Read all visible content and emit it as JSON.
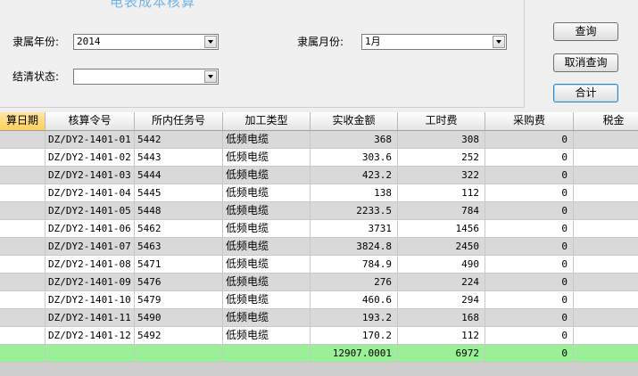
{
  "title": "电表成本核算",
  "filters": {
    "year_label": "隶属年份:",
    "year_value": "2014",
    "month_label": "隶属月份:",
    "month_value": "1月",
    "status_label": "结清状态:",
    "status_value": ""
  },
  "buttons": {
    "query": "查询",
    "cancel_query": "取消查询",
    "total": "合计"
  },
  "columns": [
    "算日期",
    "核算令号",
    "所内任务号",
    "加工类型",
    "实收金额",
    "工时费",
    "采购费",
    "税金"
  ],
  "rows": [
    {
      "order_no": "DZ/DY2-1401-01",
      "task_no": "5442",
      "type": "低频电缆",
      "amount": "368",
      "labor": "308",
      "purchase": "0"
    },
    {
      "order_no": "DZ/DY2-1401-02",
      "task_no": "5443",
      "type": "低频电缆",
      "amount": "303.6",
      "labor": "252",
      "purchase": "0"
    },
    {
      "order_no": "DZ/DY2-1401-03",
      "task_no": "5444",
      "type": "低频电缆",
      "amount": "423.2",
      "labor": "322",
      "purchase": "0"
    },
    {
      "order_no": "DZ/DY2-1401-04",
      "task_no": "5445",
      "type": "低频电缆",
      "amount": "138",
      "labor": "112",
      "purchase": "0"
    },
    {
      "order_no": "DZ/DY2-1401-05",
      "task_no": "5448",
      "type": "低频电缆",
      "amount": "2233.5",
      "labor": "784",
      "purchase": "0"
    },
    {
      "order_no": "DZ/DY2-1401-06",
      "task_no": "5462",
      "type": "低频电缆",
      "amount": "3731",
      "labor": "1456",
      "purchase": "0"
    },
    {
      "order_no": "DZ/DY2-1401-07",
      "task_no": "5463",
      "type": "低频电缆",
      "amount": "3824.8",
      "labor": "2450",
      "purchase": "0"
    },
    {
      "order_no": "DZ/DY2-1401-08",
      "task_no": "5471",
      "type": "低频电缆",
      "amount": "784.9",
      "labor": "490",
      "purchase": "0"
    },
    {
      "order_no": "DZ/DY2-1401-09",
      "task_no": "5476",
      "type": "低频电缆",
      "amount": "276",
      "labor": "224",
      "purchase": "0"
    },
    {
      "order_no": "DZ/DY2-1401-10",
      "task_no": "5479",
      "type": "低频电缆",
      "amount": "460.6",
      "labor": "294",
      "purchase": "0"
    },
    {
      "order_no": "DZ/DY2-1401-11",
      "task_no": "5490",
      "type": "低频电缆",
      "amount": "193.2",
      "labor": "168",
      "purchase": "0"
    },
    {
      "order_no": "DZ/DY2-1401-12",
      "task_no": "5492",
      "type": "低频电缆",
      "amount": "170.2",
      "labor": "112",
      "purchase": "0"
    }
  ],
  "totals": {
    "amount": "12907.0001",
    "labor": "6972",
    "purchase": "0"
  }
}
